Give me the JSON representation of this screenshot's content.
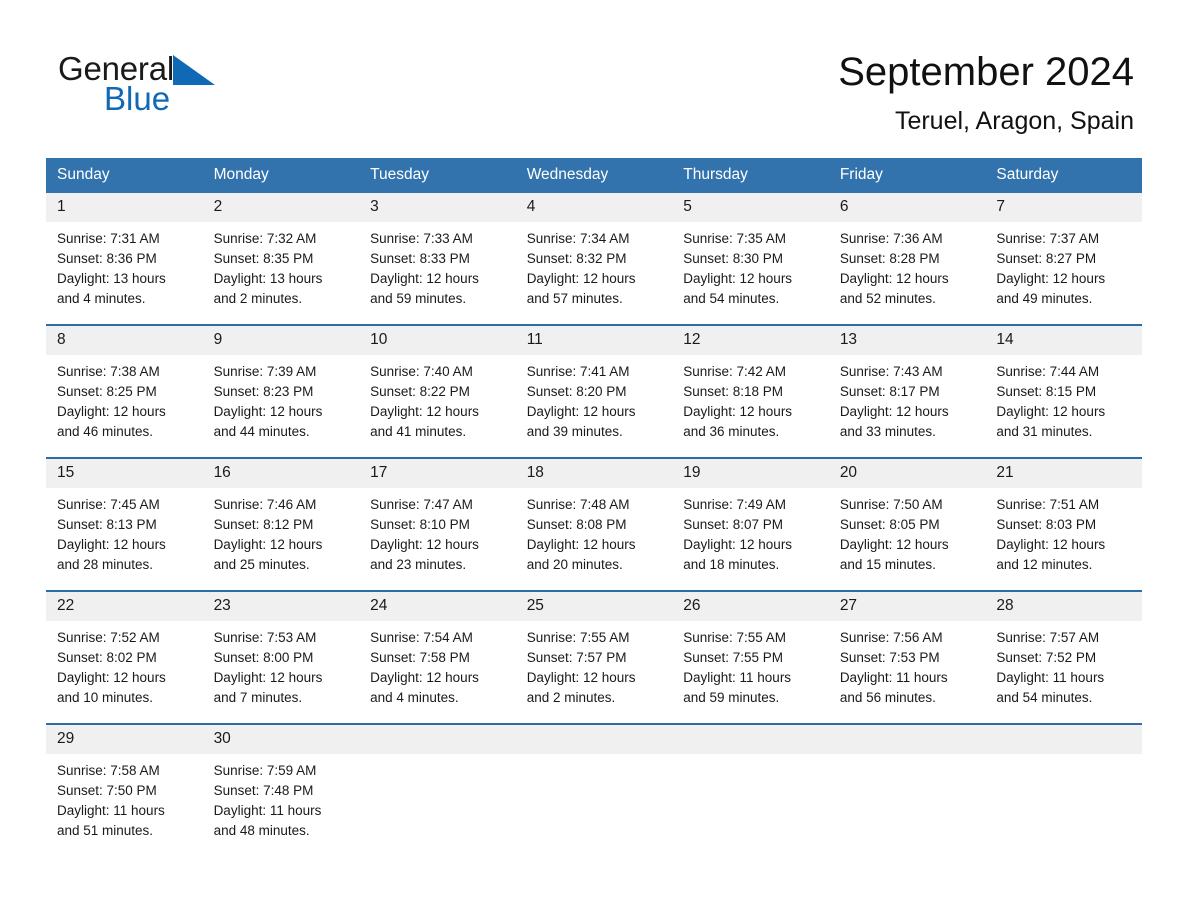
{
  "brand": {
    "name_part1": "General",
    "name_part2": "Blue",
    "accent_color": "#1069b4",
    "triangle_icon": "triangle-icon"
  },
  "header": {
    "title": "September 2024",
    "subtitle": "Teruel, Aragon, Spain"
  },
  "calendar": {
    "header_background": "#3273ad",
    "row_divider_color": "#2e6da4",
    "daynum_background": "#f0f0f0",
    "weekday_headers": [
      "Sunday",
      "Monday",
      "Tuesday",
      "Wednesday",
      "Thursday",
      "Friday",
      "Saturday"
    ],
    "weeks": [
      [
        {
          "day": "1",
          "sunrise": "Sunrise: 7:31 AM",
          "sunset": "Sunset: 8:36 PM",
          "daylight_line1": "Daylight: 13 hours",
          "daylight_line2": "and 4 minutes."
        },
        {
          "day": "2",
          "sunrise": "Sunrise: 7:32 AM",
          "sunset": "Sunset: 8:35 PM",
          "daylight_line1": "Daylight: 13 hours",
          "daylight_line2": "and 2 minutes."
        },
        {
          "day": "3",
          "sunrise": "Sunrise: 7:33 AM",
          "sunset": "Sunset: 8:33 PM",
          "daylight_line1": "Daylight: 12 hours",
          "daylight_line2": "and 59 minutes."
        },
        {
          "day": "4",
          "sunrise": "Sunrise: 7:34 AM",
          "sunset": "Sunset: 8:32 PM",
          "daylight_line1": "Daylight: 12 hours",
          "daylight_line2": "and 57 minutes."
        },
        {
          "day": "5",
          "sunrise": "Sunrise: 7:35 AM",
          "sunset": "Sunset: 8:30 PM",
          "daylight_line1": "Daylight: 12 hours",
          "daylight_line2": "and 54 minutes."
        },
        {
          "day": "6",
          "sunrise": "Sunrise: 7:36 AM",
          "sunset": "Sunset: 8:28 PM",
          "daylight_line1": "Daylight: 12 hours",
          "daylight_line2": "and 52 minutes."
        },
        {
          "day": "7",
          "sunrise": "Sunrise: 7:37 AM",
          "sunset": "Sunset: 8:27 PM",
          "daylight_line1": "Daylight: 12 hours",
          "daylight_line2": "and 49 minutes."
        }
      ],
      [
        {
          "day": "8",
          "sunrise": "Sunrise: 7:38 AM",
          "sunset": "Sunset: 8:25 PM",
          "daylight_line1": "Daylight: 12 hours",
          "daylight_line2": "and 46 minutes."
        },
        {
          "day": "9",
          "sunrise": "Sunrise: 7:39 AM",
          "sunset": "Sunset: 8:23 PM",
          "daylight_line1": "Daylight: 12 hours",
          "daylight_line2": "and 44 minutes."
        },
        {
          "day": "10",
          "sunrise": "Sunrise: 7:40 AM",
          "sunset": "Sunset: 8:22 PM",
          "daylight_line1": "Daylight: 12 hours",
          "daylight_line2": "and 41 minutes."
        },
        {
          "day": "11",
          "sunrise": "Sunrise: 7:41 AM",
          "sunset": "Sunset: 8:20 PM",
          "daylight_line1": "Daylight: 12 hours",
          "daylight_line2": "and 39 minutes."
        },
        {
          "day": "12",
          "sunrise": "Sunrise: 7:42 AM",
          "sunset": "Sunset: 8:18 PM",
          "daylight_line1": "Daylight: 12 hours",
          "daylight_line2": "and 36 minutes."
        },
        {
          "day": "13",
          "sunrise": "Sunrise: 7:43 AM",
          "sunset": "Sunset: 8:17 PM",
          "daylight_line1": "Daylight: 12 hours",
          "daylight_line2": "and 33 minutes."
        },
        {
          "day": "14",
          "sunrise": "Sunrise: 7:44 AM",
          "sunset": "Sunset: 8:15 PM",
          "daylight_line1": "Daylight: 12 hours",
          "daylight_line2": "and 31 minutes."
        }
      ],
      [
        {
          "day": "15",
          "sunrise": "Sunrise: 7:45 AM",
          "sunset": "Sunset: 8:13 PM",
          "daylight_line1": "Daylight: 12 hours",
          "daylight_line2": "and 28 minutes."
        },
        {
          "day": "16",
          "sunrise": "Sunrise: 7:46 AM",
          "sunset": "Sunset: 8:12 PM",
          "daylight_line1": "Daylight: 12 hours",
          "daylight_line2": "and 25 minutes."
        },
        {
          "day": "17",
          "sunrise": "Sunrise: 7:47 AM",
          "sunset": "Sunset: 8:10 PM",
          "daylight_line1": "Daylight: 12 hours",
          "daylight_line2": "and 23 minutes."
        },
        {
          "day": "18",
          "sunrise": "Sunrise: 7:48 AM",
          "sunset": "Sunset: 8:08 PM",
          "daylight_line1": "Daylight: 12 hours",
          "daylight_line2": "and 20 minutes."
        },
        {
          "day": "19",
          "sunrise": "Sunrise: 7:49 AM",
          "sunset": "Sunset: 8:07 PM",
          "daylight_line1": "Daylight: 12 hours",
          "daylight_line2": "and 18 minutes."
        },
        {
          "day": "20",
          "sunrise": "Sunrise: 7:50 AM",
          "sunset": "Sunset: 8:05 PM",
          "daylight_line1": "Daylight: 12 hours",
          "daylight_line2": "and 15 minutes."
        },
        {
          "day": "21",
          "sunrise": "Sunrise: 7:51 AM",
          "sunset": "Sunset: 8:03 PM",
          "daylight_line1": "Daylight: 12 hours",
          "daylight_line2": "and 12 minutes."
        }
      ],
      [
        {
          "day": "22",
          "sunrise": "Sunrise: 7:52 AM",
          "sunset": "Sunset: 8:02 PM",
          "daylight_line1": "Daylight: 12 hours",
          "daylight_line2": "and 10 minutes."
        },
        {
          "day": "23",
          "sunrise": "Sunrise: 7:53 AM",
          "sunset": "Sunset: 8:00 PM",
          "daylight_line1": "Daylight: 12 hours",
          "daylight_line2": "and 7 minutes."
        },
        {
          "day": "24",
          "sunrise": "Sunrise: 7:54 AM",
          "sunset": "Sunset: 7:58 PM",
          "daylight_line1": "Daylight: 12 hours",
          "daylight_line2": "and 4 minutes."
        },
        {
          "day": "25",
          "sunrise": "Sunrise: 7:55 AM",
          "sunset": "Sunset: 7:57 PM",
          "daylight_line1": "Daylight: 12 hours",
          "daylight_line2": "and 2 minutes."
        },
        {
          "day": "26",
          "sunrise": "Sunrise: 7:55 AM",
          "sunset": "Sunset: 7:55 PM",
          "daylight_line1": "Daylight: 11 hours",
          "daylight_line2": "and 59 minutes."
        },
        {
          "day": "27",
          "sunrise": "Sunrise: 7:56 AM",
          "sunset": "Sunset: 7:53 PM",
          "daylight_line1": "Daylight: 11 hours",
          "daylight_line2": "and 56 minutes."
        },
        {
          "day": "28",
          "sunrise": "Sunrise: 7:57 AM",
          "sunset": "Sunset: 7:52 PM",
          "daylight_line1": "Daylight: 11 hours",
          "daylight_line2": "and 54 minutes."
        }
      ],
      [
        {
          "day": "29",
          "sunrise": "Sunrise: 7:58 AM",
          "sunset": "Sunset: 7:50 PM",
          "daylight_line1": "Daylight: 11 hours",
          "daylight_line2": "and 51 minutes."
        },
        {
          "day": "30",
          "sunrise": "Sunrise: 7:59 AM",
          "sunset": "Sunset: 7:48 PM",
          "daylight_line1": "Daylight: 11 hours",
          "daylight_line2": "and 48 minutes."
        },
        {
          "day": "",
          "sunrise": "",
          "sunset": "",
          "daylight_line1": "",
          "daylight_line2": ""
        },
        {
          "day": "",
          "sunrise": "",
          "sunset": "",
          "daylight_line1": "",
          "daylight_line2": ""
        },
        {
          "day": "",
          "sunrise": "",
          "sunset": "",
          "daylight_line1": "",
          "daylight_line2": ""
        },
        {
          "day": "",
          "sunrise": "",
          "sunset": "",
          "daylight_line1": "",
          "daylight_line2": ""
        },
        {
          "day": "",
          "sunrise": "",
          "sunset": "",
          "daylight_line1": "",
          "daylight_line2": ""
        }
      ]
    ]
  }
}
